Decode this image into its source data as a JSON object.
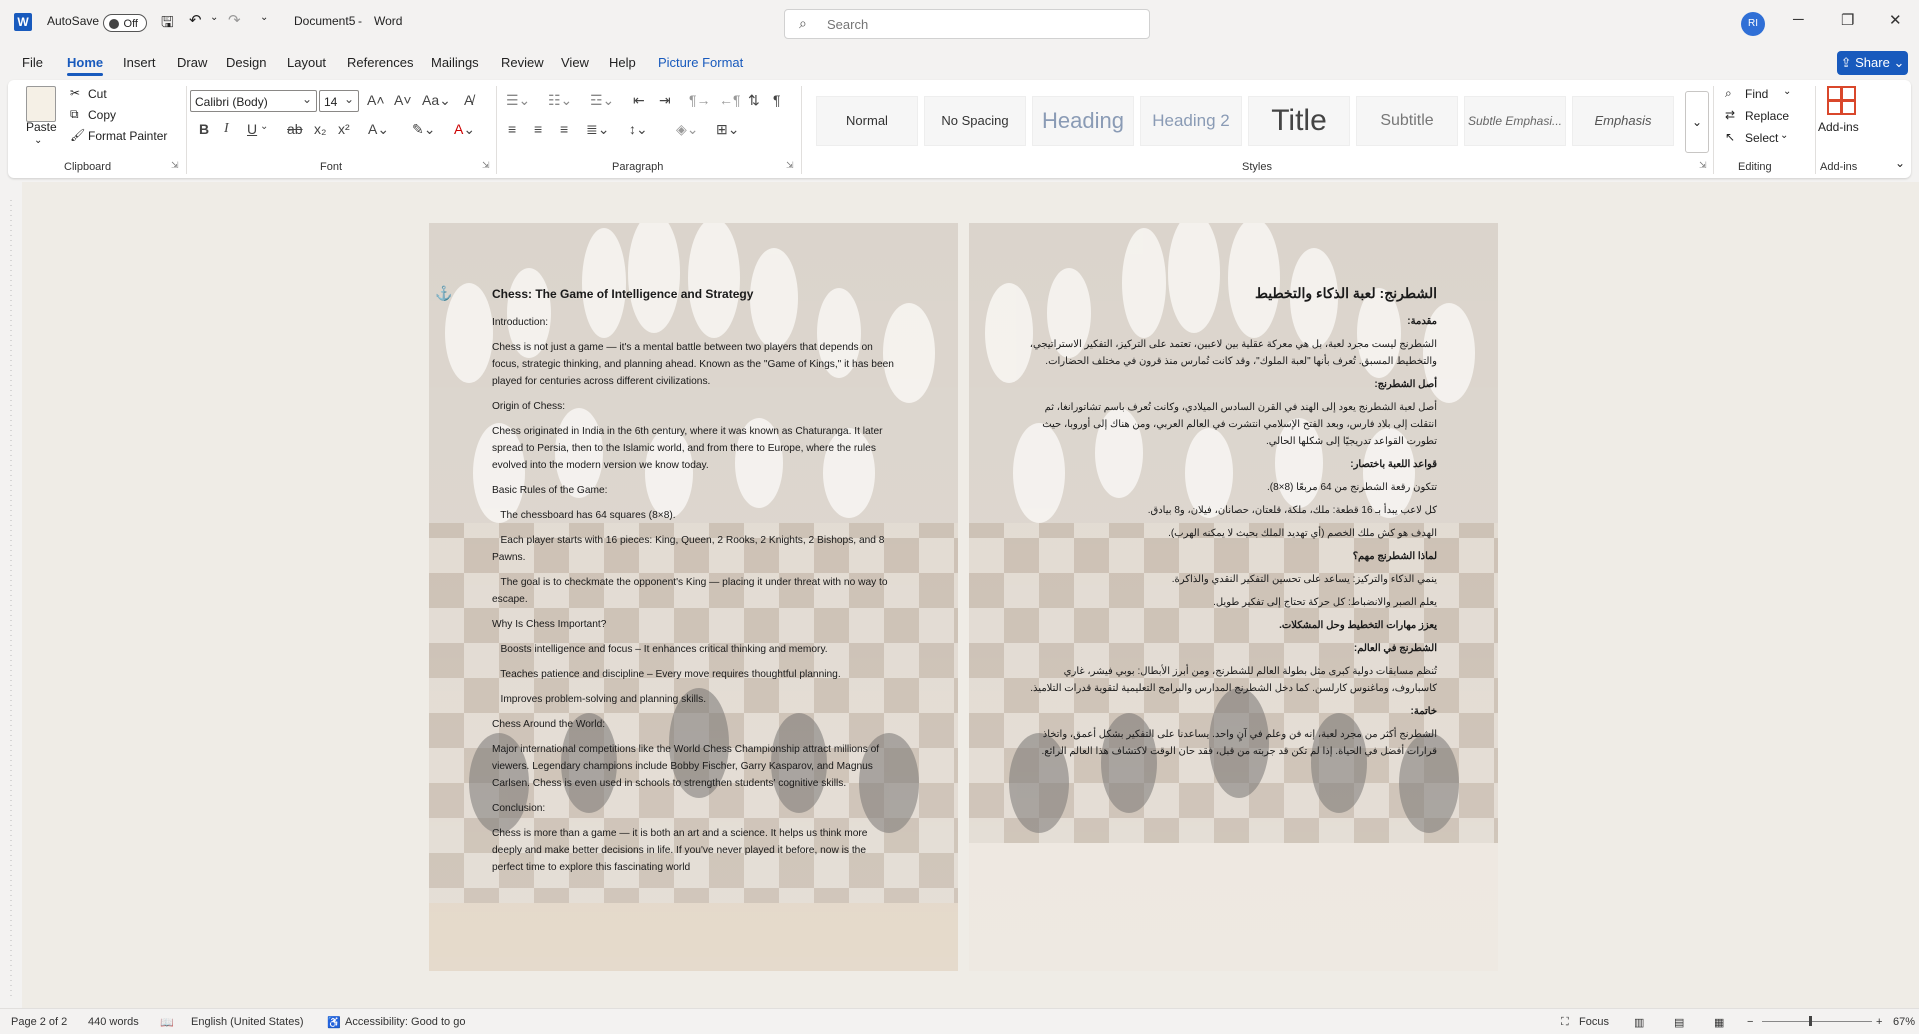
{
  "titlebar": {
    "autosave_label": "AutoSave",
    "autosave_state": "Off",
    "doc_name": "Document5",
    "app_name": "Word",
    "search_placeholder": "Search",
    "user_initials": "RI"
  },
  "tabs": [
    "File",
    "Home",
    "Insert",
    "Draw",
    "Design",
    "Layout",
    "References",
    "Mailings",
    "Review",
    "View",
    "Help",
    "Picture Format"
  ],
  "share_label": "Share",
  "ribbon": {
    "clipboard": {
      "paste": "Paste",
      "cut": "Cut",
      "copy": "Copy",
      "format_painter": "Format Painter",
      "label": "Clipboard"
    },
    "font": {
      "family": "Calibri (Body)",
      "size": "14",
      "label": "Font"
    },
    "paragraph": {
      "label": "Paragraph"
    },
    "styles": {
      "label": "Styles",
      "items": [
        "Normal",
        "No Spacing",
        "Heading",
        "Heading 2",
        "Title",
        "Subtitle",
        "Subtle Emphasi...",
        "Emphasis"
      ]
    },
    "editing": {
      "find": "Find",
      "replace": "Replace",
      "select": "Select",
      "label": "Editing"
    },
    "addins": {
      "addins": "Add-ins",
      "label": "Add-ins"
    }
  },
  "page_left": {
    "title": "Chess: The Game of Intelligence and Strategy",
    "paragraphs": [
      " Introduction:",
      "Chess is not just a game — it's a mental battle between two players that depends on focus, strategic thinking, and planning ahead. Known as the \"Game of Kings,\" it has been played for centuries across different civilizations.",
      " Origin of Chess:",
      "Chess originated in India in the 6th century, where it was known as Chaturanga. It later spread to Persia, then to the Islamic world, and from there to Europe, where the rules evolved into the modern version we know today.",
      " Basic Rules of the Game:",
      "   The chessboard has 64 squares (8×8).",
      "   Each player starts with 16 pieces: King, Queen, 2 Rooks, 2 Knights, 2 Bishops, and 8 Pawns.",
      "   The goal is to checkmate the opponent's King — placing it under threat with no way to escape.",
      " Why Is Chess Important?",
      "   Boosts intelligence and focus – It enhances critical thinking and memory.",
      "   Teaches patience and discipline – Every move requires thoughtful planning.",
      "   Improves problem-solving and planning skills.",
      " Chess Around the World:",
      "Major international competitions like the World Chess Championship attract millions of viewers. Legendary champions include Bobby Fischer, Garry Kasparov, and Magnus Carlsen. Chess is even used in schools to strengthen students' cognitive skills.",
      " Conclusion:",
      "Chess is more than a game — it is both an art and a science. It helps us think more deeply and make better decisions in life. If you've never played it before, now is the perfect time to explore this fascinating world"
    ]
  },
  "page_right": {
    "title": "الشطرنج: لعبة الذكاء والتخطيط",
    "paragraphs": [
      "مقدمة:",
      "الشطرنج ليست مجرد لعبة، بل هي معركة عقلية بين لاعبين، تعتمد على التركيز، التفكير الاستراتيجي، والتخطيط المسبق. تُعرف بأنها \"لعبة الملوك\"، وقد كانت تُمارس منذ قرون في مختلف الحضارات.",
      "أصل الشطرنج:",
      "أصل لعبة الشطرنج يعود إلى الهند في القرن السادس الميلادي، وكانت تُعرف باسم تشاتورانغا، ثم انتقلت إلى بلاد فارس، وبعد الفتح الإسلامي انتشرت في العالم العربي، ومن هناك إلى أوروبا، حيث تطورت القواعد تدريجيًا إلى شكلها الحالي.",
      "قواعد اللعبة باختصار:",
      "تتكون رقعة الشطرنج من 64 مربعًا (8×8).",
      "كل لاعب يبدأ بـ 16 قطعة: ملك، ملكة، قلعتان، حصانان، فيلان، و8 بيادق.",
      "الهدف هو كش ملك الخصم (أي تهديد الملك بحيث لا يمكنه الهرب).",
      "لماذا الشطرنج مهم؟",
      "ينمي الذكاء والتركيز: يساعد على تحسين التفكير النقدي والذاكرة.",
      "يعلم الصبر والانضباط: كل حركة تحتاج إلى تفكير طويل.",
      "يعزز مهارات التخطيط وحل المشكلات.",
      "الشطرنج في العالم:",
      "تُنظم مسابقات دولية كبرى مثل بطولة العالم للشطرنج، ومن أبرز الأبطال: بوبي فيشر، غاري كاسباروف، وماغنوس كارلسن. كما دخل الشطرنج المدارس والبرامج التعليمية لتقوية قدرات التلاميذ.",
      "خاتمة:",
      "الشطرنج أكثر من مجرد لعبة، إنه فن وعلم في آنٍ واحد. يساعدنا على التفكير بشكل أعمق، واتخاذ قرارات أفضل في الحياة. إذا لم تكن قد جربته من قبل، فقد حان الوقت لاكتشاف هذا العالم الرائع."
    ]
  },
  "status": {
    "page": "Page 2 of 2",
    "words": "440 words",
    "language": "English (United States)",
    "accessibility": "Accessibility: Good to go",
    "focus": "Focus",
    "zoom": "67%"
  },
  "colors": {
    "accent": "#185abd",
    "ribbon_bg": "#ffffff",
    "window_bg": "#f3f2f1"
  }
}
